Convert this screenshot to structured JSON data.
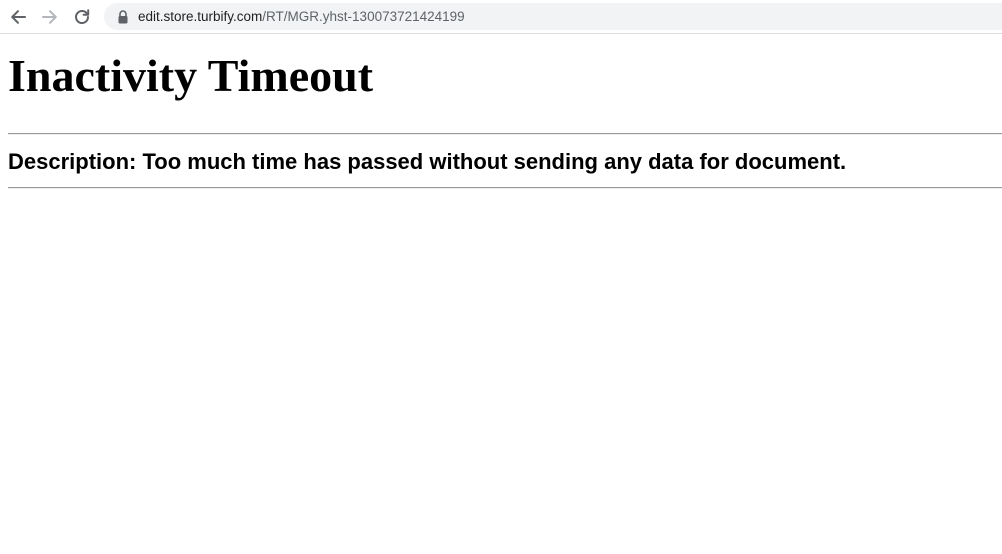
{
  "browser": {
    "url_host": "edit.store.turbify.com",
    "url_path": "/RT/MGR.yhst-130073721424199",
    "icons": {
      "back": "back-arrow-icon",
      "forward": "forward-arrow-icon",
      "reload": "reload-icon",
      "secure": "lock-icon"
    }
  },
  "page": {
    "title": "Inactivity Timeout",
    "description": "Description: Too much time has passed without sending any data for document."
  }
}
